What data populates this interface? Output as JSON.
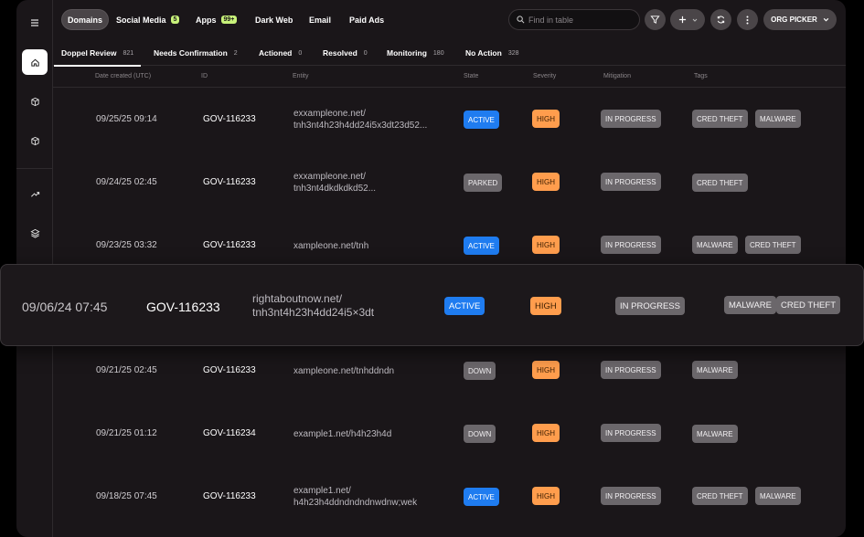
{
  "nav": {
    "tabs": [
      {
        "label": "Domains",
        "badge": ""
      },
      {
        "label": "Social Media",
        "badge": "5"
      },
      {
        "label": "Apps",
        "badge": "99+"
      },
      {
        "label": "Dark Web",
        "badge": ""
      },
      {
        "label": "Email",
        "badge": ""
      },
      {
        "label": "Paid Ads",
        "badge": ""
      }
    ],
    "active": "Domains"
  },
  "search": {
    "placeholder": "Find in table"
  },
  "toolbar": {
    "org_picker_label": "ORG PICKER"
  },
  "subtabs": [
    {
      "label": "Doppel Review",
      "count": "821"
    },
    {
      "label": "Needs Confirmation",
      "count": "2"
    },
    {
      "label": "Actioned",
      "count": "0"
    },
    {
      "label": "Resolved",
      "count": "0"
    },
    {
      "label": "Monitoring",
      "count": "180"
    },
    {
      "label": "No Action",
      "count": "328"
    }
  ],
  "table": {
    "headers": [
      "Date created (UTC)",
      "ID",
      "Entity",
      "State",
      "Severity",
      "Mitigation",
      "Tags"
    ],
    "rows": [
      {
        "date": "09/25/25 09:14",
        "id": "GOV-116233",
        "entity1": "exxampleone.net/",
        "entity2": "tnh3nt4h23h4dd24i5x3dt23d52...",
        "state": "ACTIVE",
        "severity": "HIGH",
        "mitigation": "IN PROGRESS",
        "tags": [
          "CRED THEFT",
          "MALWARE"
        ]
      },
      {
        "date": "09/24/25 02:45",
        "id": "GOV-116233",
        "entity1": "exxampleone.net/",
        "entity2": "tnh3nt4dkdkdkd52...",
        "state": "PARKED",
        "severity": "HIGH",
        "mitigation": "IN PROGRESS",
        "tags": [
          "CRED THEFT"
        ]
      },
      {
        "date": "09/23/25 03:32",
        "id": "GOV-116233",
        "entity1": "xampleone.net/tnh",
        "entity2": "",
        "state": "ACTIVE",
        "severity": "HIGH",
        "mitigation": "IN PROGRESS",
        "tags": [
          "MALWARE",
          "CRED THEFT"
        ]
      },
      {
        "date": "09/21/25 02:45",
        "id": "GOV-116233",
        "entity1": "xampleone.net/tnhddndn",
        "entity2": "",
        "state": "DOWN",
        "severity": "HIGH",
        "mitigation": "IN PROGRESS",
        "tags": [
          "MALWARE"
        ]
      },
      {
        "date": "09/21/25 01:12",
        "id": "GOV-116234",
        "entity1": "example1.net/h4h23h4d",
        "entity2": "",
        "state": "DOWN",
        "severity": "HIGH",
        "mitigation": "IN PROGRESS",
        "tags": [
          "MALWARE"
        ]
      },
      {
        "date": "09/18/25 07:45",
        "id": "GOV-116233",
        "entity1": "example1.net/",
        "entity2": "h4h23h4ddndndndnwdnw;wek",
        "state": "ACTIVE",
        "severity": "HIGH",
        "mitigation": "IN PROGRESS",
        "tags": [
          "CRED THEFT",
          "MALWARE"
        ]
      }
    ],
    "highlighted": {
      "date": "09/06/24 07:45",
      "id": "GOV-116233",
      "entity1": "rightaboutnow.net/",
      "entity2": "tnh3nt4h23h4dd24i5×3dt",
      "state": "ACTIVE",
      "severity": "HIGH",
      "mitigation": "IN PROGRESS",
      "tags": [
        "MALWARE",
        "CRED THEFT"
      ]
    }
  },
  "colors": {
    "active_state": "#1f7cf0",
    "high_severity": "#ff9d4d",
    "badge": "#c8f27a"
  }
}
